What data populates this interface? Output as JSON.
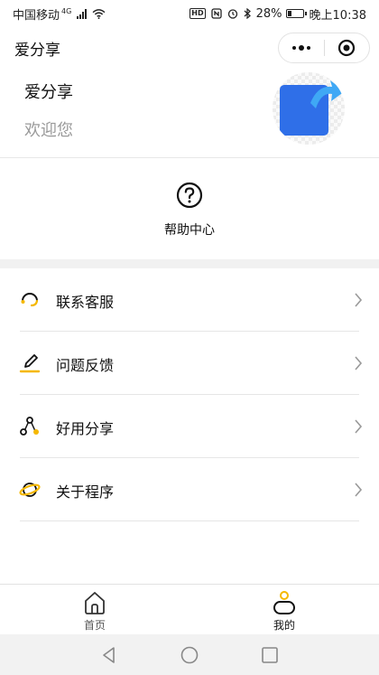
{
  "status_bar": {
    "carrier": "中国移动",
    "network": "4G",
    "battery_percent": "28%",
    "battery_level": 0.28,
    "time": "晚上10:38"
  },
  "nav": {
    "title": "爱分享"
  },
  "profile": {
    "name": "爱分享",
    "welcome": "欢迎您",
    "avatar_color": "#2f6fe8"
  },
  "help": {
    "label": "帮助中心"
  },
  "menu": {
    "items": [
      {
        "label": "联系客服",
        "icon": "headset-icon"
      },
      {
        "label": "问题反馈",
        "icon": "pencil-icon"
      },
      {
        "label": "好用分享",
        "icon": "share-nodes-icon"
      },
      {
        "label": "关于程序",
        "icon": "planet-icon"
      }
    ]
  },
  "tab_bar": {
    "tabs": [
      {
        "label": "首页",
        "icon": "home-icon",
        "active": false
      },
      {
        "label": "我的",
        "icon": "user-icon",
        "active": true
      }
    ]
  },
  "colors": {
    "accent": "#f5b800",
    "text": "#111111",
    "muted": "#9a9a9a"
  }
}
